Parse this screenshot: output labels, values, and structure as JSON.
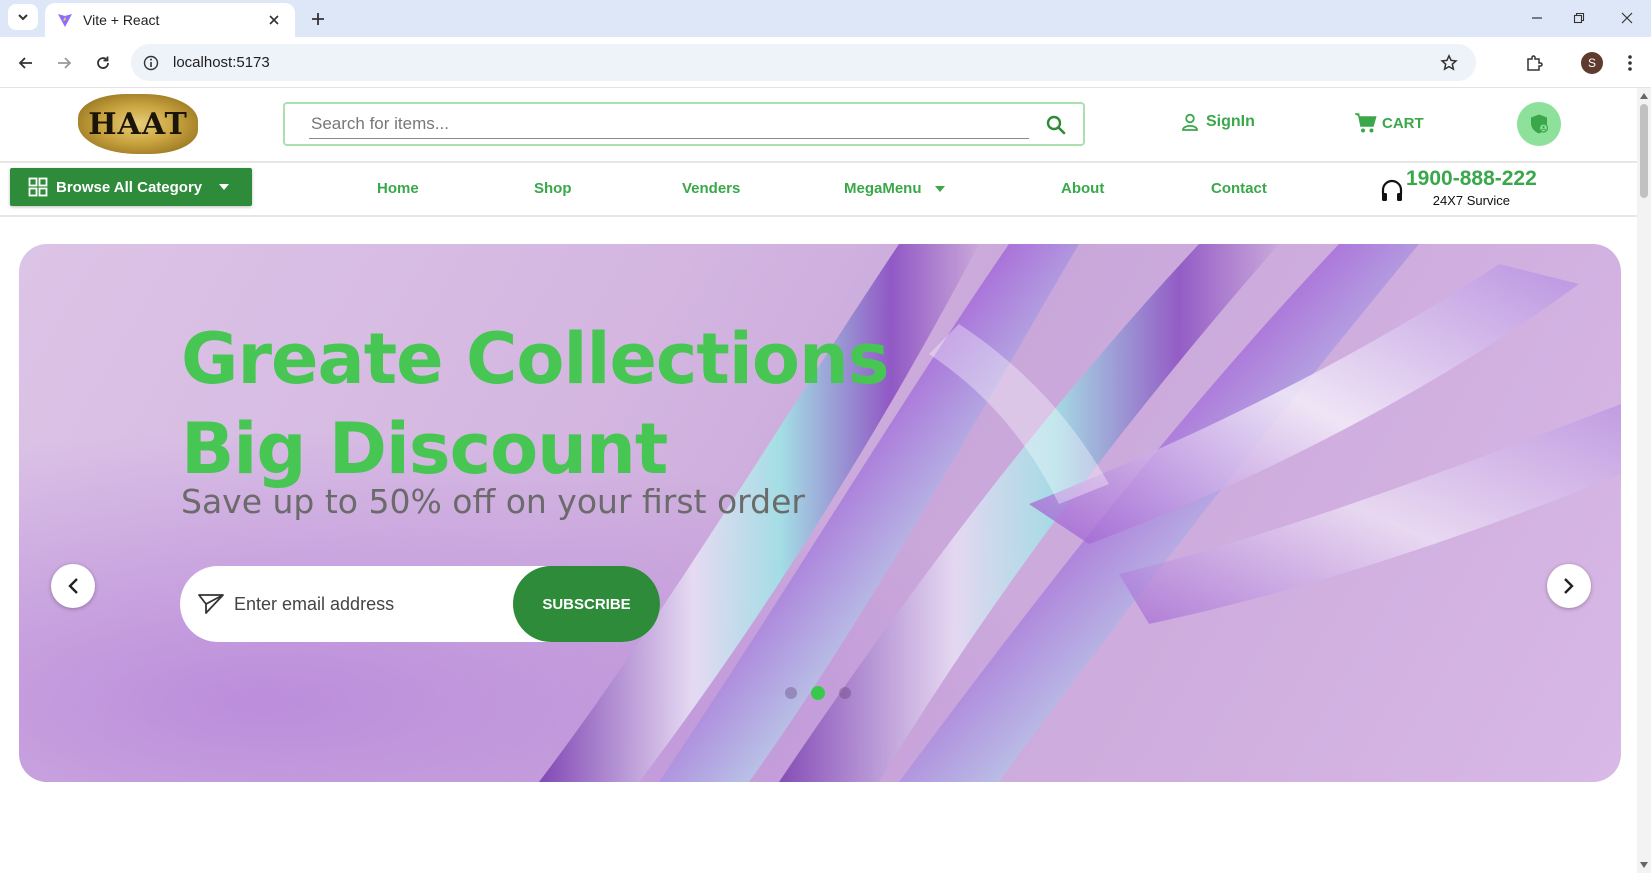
{
  "browser": {
    "tab_title": "Vite + React",
    "url": "localhost:5173",
    "profile_initial": "S"
  },
  "header": {
    "logo_text": "HAAT",
    "search_placeholder": "Search for items...",
    "signin_label": "SignIn",
    "cart_label": "CART"
  },
  "nav": {
    "browse_label": "Browse All Category",
    "links": [
      "Home",
      "Shop",
      "Venders",
      "MegaMenu",
      "About",
      "Contact"
    ],
    "phone_number": "1900-888-222",
    "phone_sub": "24X7 Survice"
  },
  "hero": {
    "title_line1": "Greate Collections",
    "title_line2": "Big Discount",
    "subtitle": "Save up to 50% off on your first order",
    "email_placeholder": "Enter email address",
    "subscribe_label": "SUBSCRIBE",
    "slide_count": 3,
    "active_slide": 2
  },
  "colors": {
    "brand_green": "#3aa84a",
    "dark_green": "#2e8b3a",
    "hero_title": "#47c653",
    "search_border": "#a8e0b0"
  }
}
